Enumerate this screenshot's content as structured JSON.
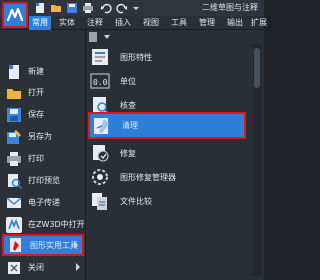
{
  "title_bar": {
    "document_title": "二维草图与注释",
    "quick_access": [
      "new-doc-icon",
      "open-folder-icon",
      "save-icon",
      "print-icon",
      "undo-icon",
      "redo-icon",
      "dropdown-icon"
    ]
  },
  "ribbon_tabs": [
    {
      "label": "常用",
      "active": true
    },
    {
      "label": "实体",
      "active": false
    },
    {
      "label": "注释",
      "active": false
    },
    {
      "label": "插入",
      "active": false
    },
    {
      "label": "视图",
      "active": false
    },
    {
      "label": "工具",
      "active": false
    },
    {
      "label": "管理",
      "active": false
    },
    {
      "label": "输出",
      "active": false
    },
    {
      "label": "扩展",
      "active": false
    }
  ],
  "file_menu": {
    "items": [
      {
        "label": "新建",
        "icon": "new-file-icon"
      },
      {
        "label": "打开",
        "icon": "open-folder-icon"
      },
      {
        "label": "保存",
        "icon": "save-icon"
      },
      {
        "label": "另存为",
        "icon": "save-as-icon"
      },
      {
        "label": "打印",
        "icon": "print-icon"
      },
      {
        "label": "打印预览",
        "icon": "print-preview-icon"
      },
      {
        "label": "电子传递",
        "icon": "etransmit-icon"
      },
      {
        "label": "在ZW3D中打开",
        "icon": "zw3d-icon"
      },
      {
        "label": "图形实用工具",
        "icon": "drawing-utilities-icon",
        "selected": true,
        "has_submenu": true
      },
      {
        "label": "关闭",
        "icon": "close-file-icon",
        "has_submenu": true
      }
    ]
  },
  "submenu": {
    "items": [
      {
        "label": "图形特性",
        "icon": "drawing-properties-icon"
      },
      {
        "label": "单位",
        "icon": "units-icon"
      },
      {
        "label": "核查",
        "icon": "audit-icon"
      },
      {
        "label": "清理",
        "icon": "purge-icon",
        "selected": true
      },
      {
        "label": "修复",
        "icon": "recover-icon"
      },
      {
        "label": "图形修复管理器",
        "icon": "recovery-manager-icon"
      },
      {
        "label": "文件比较",
        "icon": "file-compare-icon"
      }
    ]
  },
  "colors": {
    "accent": "#2f7fd8",
    "highlight_border": "#e0161a",
    "panel_bg": "#2a2f35"
  }
}
